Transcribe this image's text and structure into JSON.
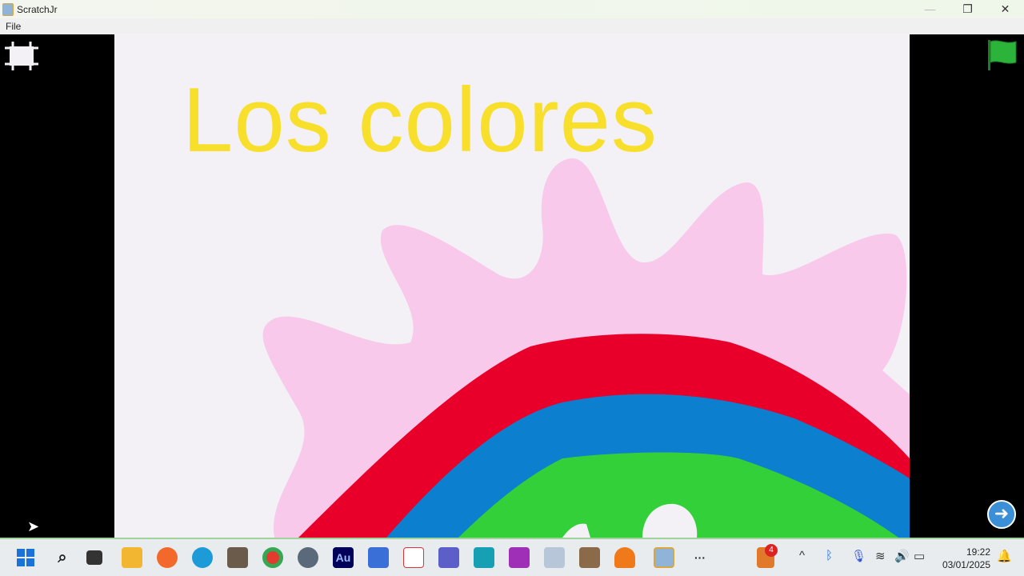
{
  "window": {
    "title": "ScratchJr",
    "minimize": "—",
    "maximize": "❐",
    "close": "✕"
  },
  "menu": {
    "file": "File"
  },
  "stage": {
    "title": "Los colores"
  },
  "colors": {
    "title": "#f8df2c",
    "sun": "#f8c9ea",
    "red": "#e8002a",
    "blue": "#0c7fcf",
    "green": "#33d03a"
  },
  "taskbar": {
    "apps": [
      "start",
      "search",
      "task-view",
      "file-explorer",
      "firefox",
      "edge",
      "gimp",
      "chrome",
      "settings",
      "audition",
      "power-automate",
      "office",
      "teams",
      "edu",
      "clipchamp",
      "scratch-cat",
      "minecraft",
      "slime",
      "scratchjr",
      "more"
    ],
    "more_label": "···",
    "notification_count": "4",
    "time": "19:22",
    "date": "03/01/2025"
  }
}
